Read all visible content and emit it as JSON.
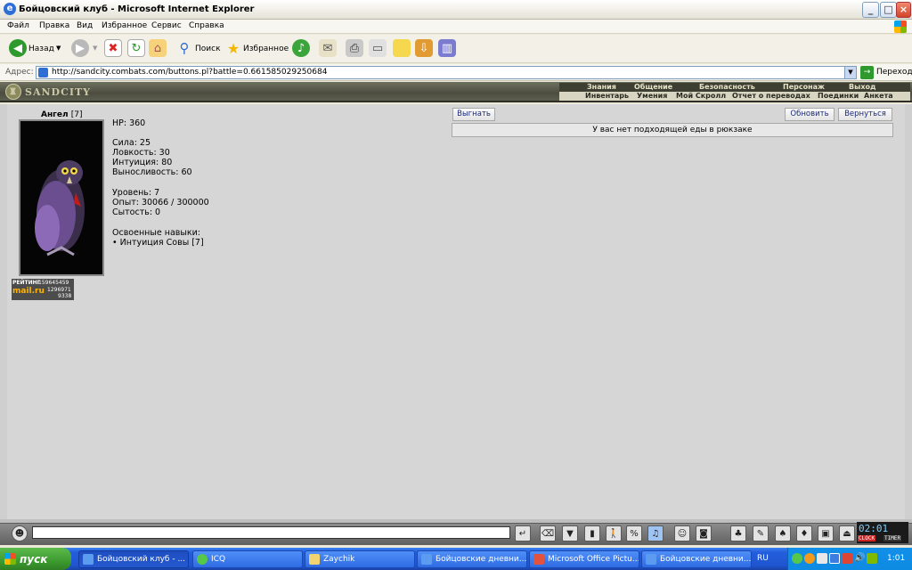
{
  "window": {
    "title": "Бойцовский клуб - Microsoft Internet Explorer"
  },
  "menu": {
    "items": [
      "Файл",
      "Правка",
      "Вид",
      "Избранное",
      "Сервис",
      "Справка"
    ]
  },
  "toolbar": {
    "back_label": "Назад",
    "search_label": "Поиск",
    "favorites_label": "Избранное"
  },
  "address": {
    "label": "Адрес:",
    "url": "http://sandcity.combats.com/buttons.pl?battle=0.661585029250684",
    "go_label": "Переход"
  },
  "game": {
    "logo": "SANDCITY",
    "topnav": [
      "Знания",
      "Общение",
      "Безопасность",
      "Персонаж",
      "Выход"
    ],
    "subnav": [
      "Инвентарь",
      "Умения",
      "Мой Скролл",
      "Отчет о переводах",
      "Поединки",
      "Анкета"
    ]
  },
  "character": {
    "name": "Ангел",
    "level_tag": "[7]",
    "hp": "HP: 360",
    "strength": "Сила: 25",
    "agility": "Ловкость: 30",
    "intuition": "Интуиция: 80",
    "endurance": "Выносливость: 60",
    "level": "Уровень: 7",
    "experience": "Опыт: 30066 / 300000",
    "satiety": "Сытость: 0",
    "skills_header": "Освоенные навыки:",
    "skill_1": "• Интуиция Совы [7]"
  },
  "rating": {
    "label": "РЕЙТИНГ",
    "brand": "mail.ru",
    "n1": "159645459",
    "n2": "1296971",
    "n3": "9338"
  },
  "actions": {
    "kick": "Выгнать",
    "refresh": "Обновить",
    "back": "Вернуться"
  },
  "messages": {
    "food": "У вас нет подходящей еды в рюкзаке"
  },
  "clock": {
    "time": "02:01",
    "label1": "CLOCK",
    "label2": "TIMER"
  },
  "taskbar": {
    "start": "пуск",
    "tasks": [
      "Бойцовский клуб - ...",
      "ICQ",
      "Zaychik",
      "Бойцовские дневни...",
      "Microsoft Office Pictu...",
      "Бойцовские дневни..."
    ],
    "lang": "RU",
    "time": "1:01"
  },
  "colors": {
    "xp_blue": "#245EDC",
    "start_green": "#3C9B2F",
    "game_frame": "#4C4D40"
  }
}
